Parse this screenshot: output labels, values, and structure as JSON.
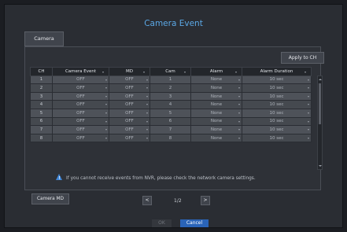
{
  "title": "Camera Event",
  "tab_label": "Camera",
  "apply_button": "Apply to CH",
  "columns": [
    "CH",
    "Camera Event",
    "MD",
    "Cam",
    "Alarm",
    "Alarm Duration"
  ],
  "rows": [
    {
      "ch": "1",
      "event": "OFF",
      "md": "OFF",
      "cam": "1",
      "alarm": "None",
      "duration": "10 sec"
    },
    {
      "ch": "2",
      "event": "OFF",
      "md": "OFF",
      "cam": "2",
      "alarm": "None",
      "duration": "10 sec"
    },
    {
      "ch": "3",
      "event": "OFF",
      "md": "OFF",
      "cam": "3",
      "alarm": "None",
      "duration": "10 sec"
    },
    {
      "ch": "4",
      "event": "OFF",
      "md": "OFF",
      "cam": "4",
      "alarm": "None",
      "duration": "10 sec"
    },
    {
      "ch": "5",
      "event": "OFF",
      "md": "OFF",
      "cam": "5",
      "alarm": "None",
      "duration": "10 sec"
    },
    {
      "ch": "6",
      "event": "OFF",
      "md": "OFF",
      "cam": "6",
      "alarm": "None",
      "duration": "10 sec"
    },
    {
      "ch": "7",
      "event": "OFF",
      "md": "OFF",
      "cam": "7",
      "alarm": "None",
      "duration": "10 sec"
    },
    {
      "ch": "8",
      "event": "OFF",
      "md": "OFF",
      "cam": "8",
      "alarm": "None",
      "duration": "10 sec"
    }
  ],
  "notice": "If you cannot receive events from NVR, please check the network camera settings.",
  "camera_md_button": "Camera MD",
  "pagination": {
    "prev": "<",
    "next": ">",
    "page": "1/2"
  },
  "ok_button": "OK",
  "cancel_button": "Cancel"
}
